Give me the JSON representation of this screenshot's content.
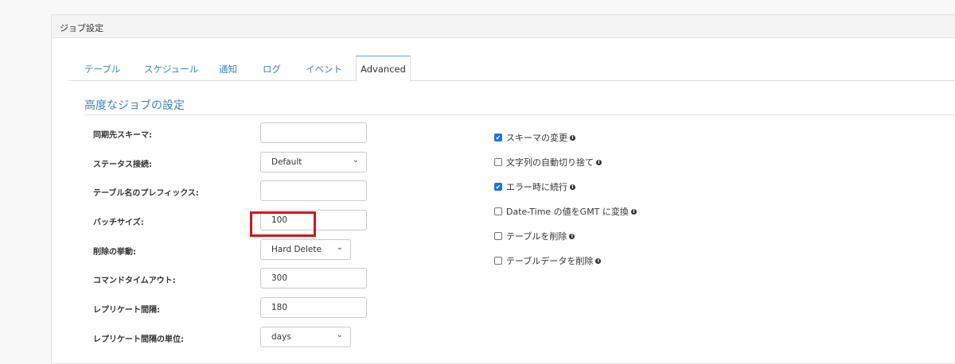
{
  "panel_title": "ジョブ設定",
  "tabs": [
    "テーブル",
    "スケジュール",
    "通知",
    "ログ",
    "イベント",
    "Advanced"
  ],
  "active_tab": "Advanced",
  "section_title": "高度なジョブの設定",
  "fields": [
    {
      "label": "同期先スキーマ:",
      "value": "",
      "type": "text"
    },
    {
      "label": "ステータス接続:",
      "value": "Default",
      "type": "select"
    },
    {
      "label": "テーブル名のプレフィックス:",
      "value": "",
      "type": "text"
    },
    {
      "label": "バッチサイズ:",
      "value": "100",
      "type": "text"
    },
    {
      "label": "削除の挙動:",
      "value": "Hard Delete",
      "type": "select"
    },
    {
      "label": "コマンドタイムアウト:",
      "value": "300",
      "type": "text"
    },
    {
      "label": "レプリケート間隔:",
      "value": "180",
      "type": "text"
    },
    {
      "label": "レプリケート間隔の単位:",
      "value": "days",
      "type": "select"
    }
  ],
  "checkboxes": [
    {
      "label": "スキーマの変更",
      "checked": true
    },
    {
      "label": "文字列の自動切り捨て",
      "checked": false
    },
    {
      "label": "エラー時に続行",
      "checked": true
    },
    {
      "label": "Date-Time の値をGMT に変換",
      "checked": false
    },
    {
      "label": "テーブルを削除",
      "checked": false
    },
    {
      "label": "テーブルデータを削除",
      "checked": false
    }
  ],
  "info_glyph": "i",
  "highlight_color": "#d7141c"
}
